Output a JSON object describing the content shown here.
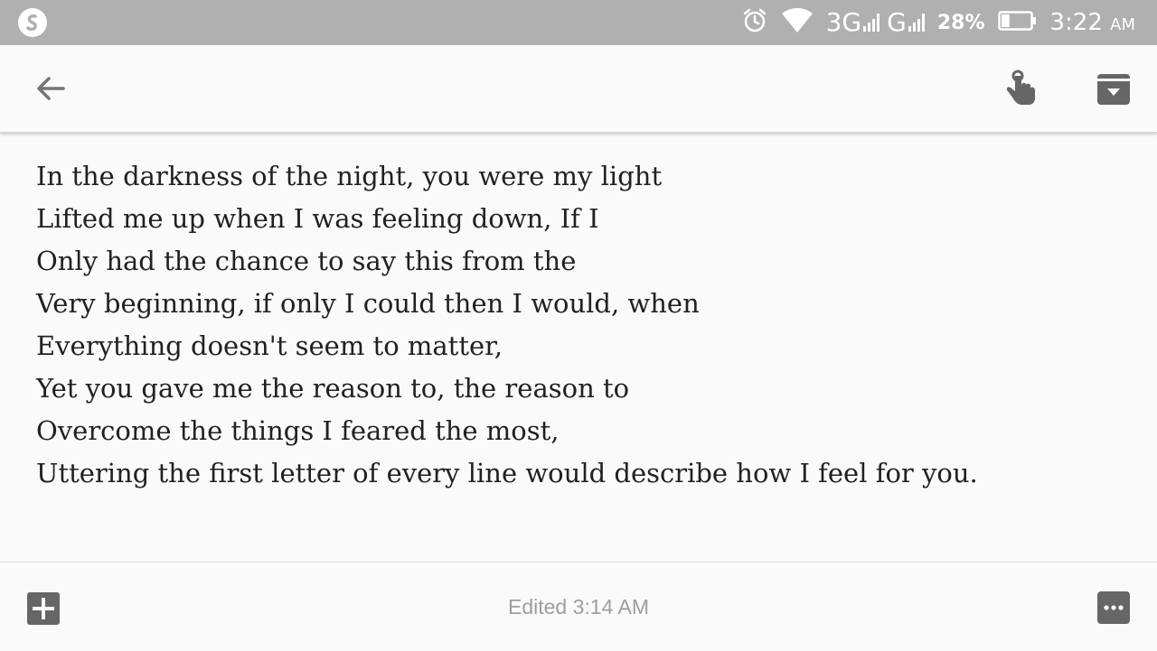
{
  "status_bar": {
    "network_primary": "3G",
    "network_secondary": "G",
    "battery_percent": "28%",
    "battery_level": 0.28,
    "time": "3:22",
    "time_suffix": "AM",
    "icons": [
      "app-notification-icon",
      "alarm-icon",
      "wifi-icon",
      "signal-bars-icon",
      "battery-icon"
    ]
  },
  "toolbar": {
    "icons": [
      "back-arrow-icon",
      "pin-icon",
      "archive-icon"
    ]
  },
  "note": {
    "lines": [
      "In the darkness of the night, you were my light",
      "Lifted me up when I was feeling down, If I",
      "Only had the chance to say this from the",
      "Very beginning, if only I could then I would, when",
      "Everything doesn't seem to matter,",
      "Yet you gave me the reason to, the reason to",
      "Overcome the things I feared the most,",
      "Uttering the first letter of every line would describe how I feel for you."
    ]
  },
  "bottom_bar": {
    "edited_text": "Edited 3:14 AM",
    "icons": [
      "add-icon",
      "more-options-icon"
    ]
  },
  "colors": {
    "status_bar_bg": "#b0b0b0",
    "page_bg": "#fafafa",
    "icon_gray": "#666666",
    "text": "#212121",
    "muted_text": "#9e9e9e"
  }
}
